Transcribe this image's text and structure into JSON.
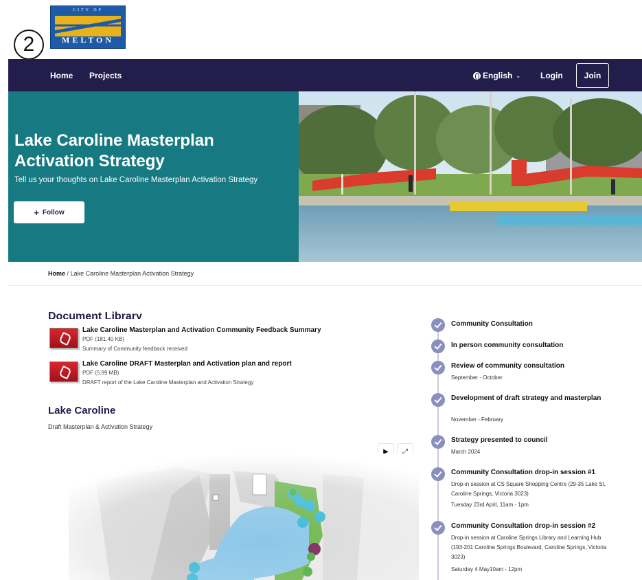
{
  "badge": {
    "number": "2"
  },
  "logo": {
    "top_text": "CITY OF",
    "name": "MELTON"
  },
  "nav": {
    "home": "Home",
    "projects": "Projects",
    "language": "English",
    "login": "Login",
    "join": "Join"
  },
  "hero": {
    "title": "Lake Caroline Masterplan Activation Strategy",
    "subtitle": "Tell us your thoughts on Lake Caroline Masterplan Activation Strategy",
    "follow": "Follow"
  },
  "breadcrumb": {
    "home": "Home",
    "separator": "/",
    "current": "Lake Caroline Masterplan Activation Strategy"
  },
  "documents": {
    "heading": "Document Library",
    "items": [
      {
        "title": "Lake Caroline Masterplan and Activation Community Feedback Summary",
        "meta": "PDF (181.40 KB)",
        "description": "Summary of Community feedback received"
      },
      {
        "title": "Lake Caroline DRAFT Masterplan and Activation plan and report",
        "meta": "PDF (5.99 MB)",
        "description": "DRAFT report of the Lake Caroline Masterplan and Activation Strategy"
      }
    ]
  },
  "lake": {
    "heading": "Lake Caroline",
    "subheading": "Draft Masterplan & Activation Strategy"
  },
  "timeline": [
    {
      "title": "Community Consultation",
      "lines": []
    },
    {
      "title": "In person community consultation",
      "lines": []
    },
    {
      "title": "Review of community consultation",
      "lines": [
        "September - October"
      ]
    },
    {
      "title": "Development of draft strategy and masterplan",
      "lines": [
        "November - February"
      ]
    },
    {
      "title": "Strategy presented to council",
      "lines": [
        "March 2024"
      ]
    },
    {
      "title": "Community Consultation drop-in session #1",
      "lines": [
        "Drop-in session at CS Square Shopping Centre (29-35 Lake St, Caroline Springs, Victoria 3023)",
        "Tuesday 23rd April, 11am - 1pm"
      ]
    },
    {
      "title": "Community Consultation drop-in session #2",
      "lines": [
        "Drop-in session at Caroline Springs Library and Learning Hub (193-201 Caroline Springs Boulevard, Caroline Springs, Victoria 3023)",
        "Saturday 4 May10am - 12pm"
      ]
    }
  ],
  "colors": {
    "navbar": "#221d4b",
    "hero_teal": "#177a82",
    "timeline_check": "#8b8fbe"
  }
}
